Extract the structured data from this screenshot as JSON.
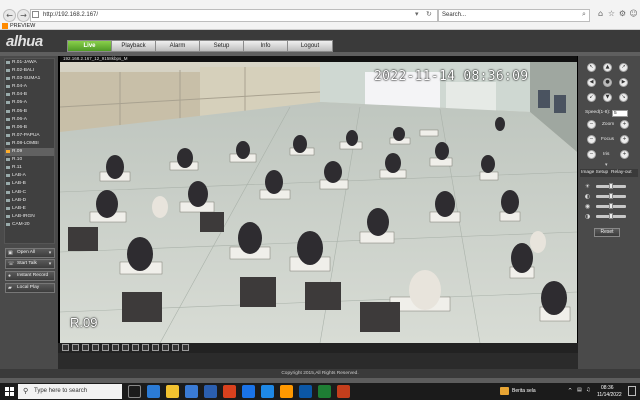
{
  "browser": {
    "url": "http://192.168.2.167/",
    "search_placeholder": "Search...",
    "tab_title": "PREVIEW",
    "refresh_icon": "refresh-icon",
    "back_icon": "back-arrow-icon"
  },
  "app": {
    "logo": "alhua",
    "menu": [
      "Live",
      "Playback",
      "Alarm",
      "Setup",
      "Info",
      "Logout"
    ],
    "active_menu": "Live",
    "accent": "#5dab2e"
  },
  "devices": [
    "R.01-JAWA",
    "R.02-BALI",
    "R.03-SUMA1",
    "R.04-A",
    "R.04-B",
    "R.05-A",
    "R.05-B",
    "R.06-A",
    "R.06-B",
    "R.07-PAPUA",
    "R.08-LOMBI",
    "R.09",
    "R.10",
    "R.11",
    "LAB-A",
    "LAB-B",
    "LAB-C",
    "LAB-D",
    "LAB-E",
    "LAB-IRGN",
    "CAM-20"
  ],
  "selected_device": "R.09",
  "left_buttons": {
    "open_all": "Open All",
    "start_talk": "Start Talk",
    "instant_record": "Instant Record",
    "local_play": "Local Play"
  },
  "video": {
    "info": "192.168.2.167_12_9158kbps_M",
    "osd_time": "2022-11-14 08:36:09",
    "osd_name": "R.09"
  },
  "ptz": {
    "speed_label": "Speed(1-8):",
    "speed_value": "5",
    "zoom": "Zoom",
    "focus": "Focus",
    "iris": "Iris"
  },
  "image_setup": {
    "tab1": "Image Setup",
    "tab2": "Relay-out",
    "reset": "Reset",
    "levels": [
      0.5,
      0.5,
      0.5,
      0.5
    ]
  },
  "footer": {
    "copyright": "Copyright 2015,All Rights Reserved."
  },
  "taskbar": {
    "search_placeholder": "Type here to search",
    "news": "Berita sela",
    "time": "08:36",
    "date": "11/14/2022"
  }
}
